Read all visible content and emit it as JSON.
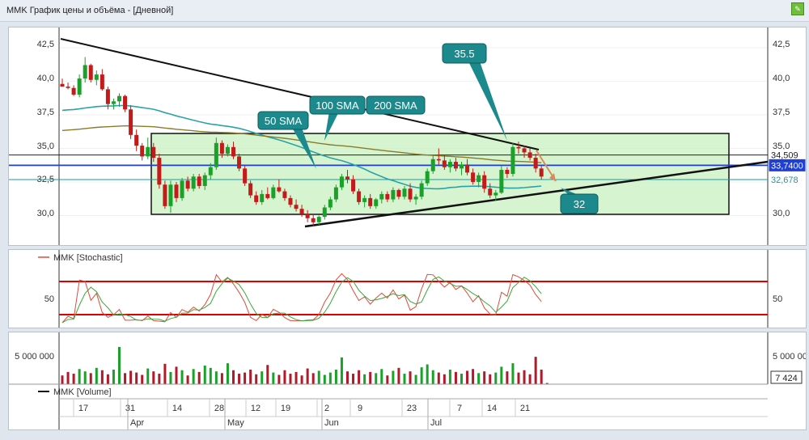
{
  "window": {
    "title": "MMK График цены и объёма - [Дневной]"
  },
  "price_panel": {
    "y_ticks": [
      "42,5",
      "40,0",
      "37,5",
      "35,0",
      "32,5",
      "30,0"
    ],
    "right_ticks": [
      "42,5",
      "40,0",
      "37,5",
      "35,0",
      "30,0"
    ],
    "markers": [
      {
        "label": "34,509",
        "value": 34.509,
        "color": "#222222"
      },
      {
        "label": "33,7400",
        "value": 33.74,
        "color": "#1f3fd6"
      },
      {
        "label": "32,678",
        "value": 32.678,
        "color": "#1a9aa0"
      }
    ],
    "callouts": {
      "sma50": "50 SMA",
      "sma100": "100 SMA",
      "sma200": "200 SMA",
      "high": "35.5",
      "target": "32"
    }
  },
  "stoch_panel": {
    "legend": "MMK [Stochastic]",
    "tick": "50"
  },
  "volume_panel": {
    "tick": "5 000 000",
    "last_value": "7 424",
    "legend": "MMK [Volume]"
  },
  "time_axis": {
    "days": [
      "17",
      "31",
      "14",
      "28",
      "12",
      "19",
      "2",
      "9",
      "23",
      "7",
      "14",
      "21"
    ],
    "months": [
      "Apr",
      "May",
      "Jun",
      "Jul"
    ]
  },
  "chart_data": {
    "type": "candlestick",
    "ylim": [
      27.8,
      44.0
    ],
    "candles": [
      [
        39.8,
        40.2,
        39.6,
        39.6
      ],
      [
        39.6,
        39.9,
        39.4,
        39.5
      ],
      [
        39.5,
        39.7,
        38.9,
        39.0
      ],
      [
        39.0,
        40.5,
        38.8,
        40.2
      ],
      [
        40.2,
        41.8,
        39.9,
        41.2
      ],
      [
        41.2,
        41.3,
        39.9,
        40.1
      ],
      [
        40.1,
        40.8,
        39.7,
        40.5
      ],
      [
        40.5,
        40.9,
        39.3,
        39.4
      ],
      [
        39.4,
        39.6,
        37.9,
        38.3
      ],
      [
        38.3,
        38.7,
        37.9,
        38.5
      ],
      [
        38.5,
        39.1,
        38.1,
        38.9
      ],
      [
        38.9,
        39.0,
        37.7,
        37.9
      ],
      [
        37.9,
        38.2,
        35.7,
        36.0
      ],
      [
        36.0,
        36.4,
        34.8,
        35.2
      ],
      [
        35.2,
        35.4,
        34.1,
        34.4
      ],
      [
        34.4,
        35.8,
        34.2,
        35.1
      ],
      [
        35.1,
        35.4,
        34.0,
        34.3
      ],
      [
        34.3,
        34.6,
        32.0,
        32.3
      ],
      [
        32.3,
        32.6,
        30.5,
        30.7
      ],
      [
        30.7,
        32.6,
        30.2,
        32.3
      ],
      [
        32.3,
        32.5,
        31.0,
        31.3
      ],
      [
        31.3,
        32.8,
        31.1,
        32.6
      ],
      [
        32.6,
        32.9,
        31.8,
        32.0
      ],
      [
        32.0,
        33.1,
        31.8,
        32.9
      ],
      [
        32.9,
        33.1,
        32.0,
        32.2
      ],
      [
        32.2,
        33.2,
        31.9,
        33.0
      ],
      [
        33.0,
        33.9,
        32.7,
        33.6
      ],
      [
        33.6,
        35.8,
        33.4,
        35.4
      ],
      [
        35.4,
        35.6,
        34.3,
        34.6
      ],
      [
        34.6,
        35.3,
        34.4,
        35.1
      ],
      [
        35.1,
        35.5,
        34.2,
        34.4
      ],
      [
        34.4,
        34.6,
        33.3,
        33.5
      ],
      [
        33.5,
        33.7,
        32.2,
        32.4
      ],
      [
        32.4,
        32.6,
        31.3,
        31.5
      ],
      [
        31.5,
        31.8,
        30.8,
        31.0
      ],
      [
        31.0,
        31.9,
        30.8,
        31.6
      ],
      [
        31.6,
        32.1,
        31.2,
        31.3
      ],
      [
        31.3,
        32.3,
        31.2,
        32.1
      ],
      [
        32.1,
        32.7,
        31.7,
        31.8
      ],
      [
        31.8,
        32.0,
        31.1,
        31.3
      ],
      [
        31.3,
        31.5,
        30.6,
        30.8
      ],
      [
        30.8,
        31.2,
        30.3,
        30.5
      ],
      [
        30.5,
        30.8,
        29.9,
        30.1
      ],
      [
        30.1,
        30.4,
        29.5,
        29.8
      ],
      [
        29.8,
        30.1,
        29.2,
        29.5
      ],
      [
        29.5,
        30.0,
        29.3,
        29.9
      ],
      [
        29.9,
        30.8,
        29.7,
        30.6
      ],
      [
        30.6,
        31.4,
        30.4,
        31.2
      ],
      [
        31.2,
        32.3,
        31.0,
        32.1
      ],
      [
        32.1,
        33.1,
        31.9,
        32.9
      ],
      [
        32.9,
        33.4,
        32.4,
        32.7
      ],
      [
        32.7,
        33.0,
        31.6,
        31.8
      ],
      [
        31.8,
        32.0,
        30.8,
        31.0
      ],
      [
        31.0,
        31.5,
        30.6,
        31.3
      ],
      [
        31.3,
        31.6,
        30.5,
        30.7
      ],
      [
        30.7,
        31.3,
        30.5,
        31.2
      ],
      [
        31.2,
        31.8,
        30.9,
        31.6
      ],
      [
        31.6,
        31.8,
        31.0,
        31.2
      ],
      [
        31.2,
        32.1,
        31.0,
        31.9
      ],
      [
        31.9,
        32.0,
        31.2,
        31.4
      ],
      [
        31.4,
        32.2,
        31.2,
        32.0
      ],
      [
        32.0,
        32.4,
        31.0,
        31.2
      ],
      [
        31.2,
        31.6,
        30.8,
        31.4
      ],
      [
        31.4,
        32.6,
        31.2,
        32.4
      ],
      [
        32.4,
        33.5,
        32.2,
        33.3
      ],
      [
        33.3,
        34.5,
        33.1,
        34.2
      ],
      [
        34.2,
        35.0,
        33.8,
        34.1
      ],
      [
        34.1,
        34.5,
        33.4,
        33.6
      ],
      [
        33.6,
        34.2,
        33.2,
        34.0
      ],
      [
        34.0,
        34.3,
        33.3,
        33.5
      ],
      [
        33.5,
        34.0,
        33.0,
        33.8
      ],
      [
        33.8,
        34.2,
        33.0,
        33.2
      ],
      [
        33.2,
        33.5,
        32.3,
        32.5
      ],
      [
        32.5,
        33.2,
        32.1,
        33.0
      ],
      [
        33.0,
        33.3,
        31.7,
        32.0
      ],
      [
        32.0,
        32.4,
        31.3,
        31.5
      ],
      [
        31.5,
        31.9,
        31.1,
        31.7
      ],
      [
        31.7,
        33.7,
        31.6,
        33.4
      ],
      [
        33.4,
        33.6,
        32.8,
        33.1
      ],
      [
        33.1,
        35.4,
        32.9,
        35.1
      ],
      [
        35.1,
        35.5,
        34.6,
        35.0
      ],
      [
        35.0,
        35.2,
        34.3,
        34.7
      ],
      [
        34.7,
        35.0,
        34.1,
        34.3
      ],
      [
        34.3,
        34.6,
        33.2,
        33.5
      ],
      [
        33.5,
        33.7,
        32.7,
        32.9
      ]
    ],
    "volumes": [
      1.5,
      2.1,
      1.8,
      2.6,
      2.2,
      1.9,
      2.8,
      2.4,
      1.7,
      2.5,
      6.4,
      1.9,
      2.3,
      2.0,
      1.6,
      2.7,
      2.2,
      1.8,
      3.5,
      2.1,
      3.0,
      2.4,
      1.5,
      2.6,
      2.1,
      3.2,
      2.8,
      2.2,
      1.9,
      3.6,
      2.4,
      1.8,
      2.0,
      2.5,
      1.7,
      2.2,
      3.3,
      2.0,
      1.6,
      2.4,
      1.8,
      2.1,
      1.5,
      2.7,
      1.9,
      2.3,
      1.6,
      2.0,
      2.5,
      4.6,
      2.2,
      1.8,
      2.4,
      1.7,
      2.1,
      1.9,
      2.6,
      1.5,
      2.3,
      2.8,
      1.8,
      2.2,
      1.6,
      2.9,
      3.4,
      2.4,
      2.0,
      1.7,
      2.5,
      2.1,
      1.8,
      2.3,
      2.6,
      1.9,
      2.2,
      1.7,
      2.0,
      3.0,
      2.2,
      3.6,
      2.0,
      2.4,
      1.7,
      4.7,
      2.5,
      0.2
    ]
  }
}
